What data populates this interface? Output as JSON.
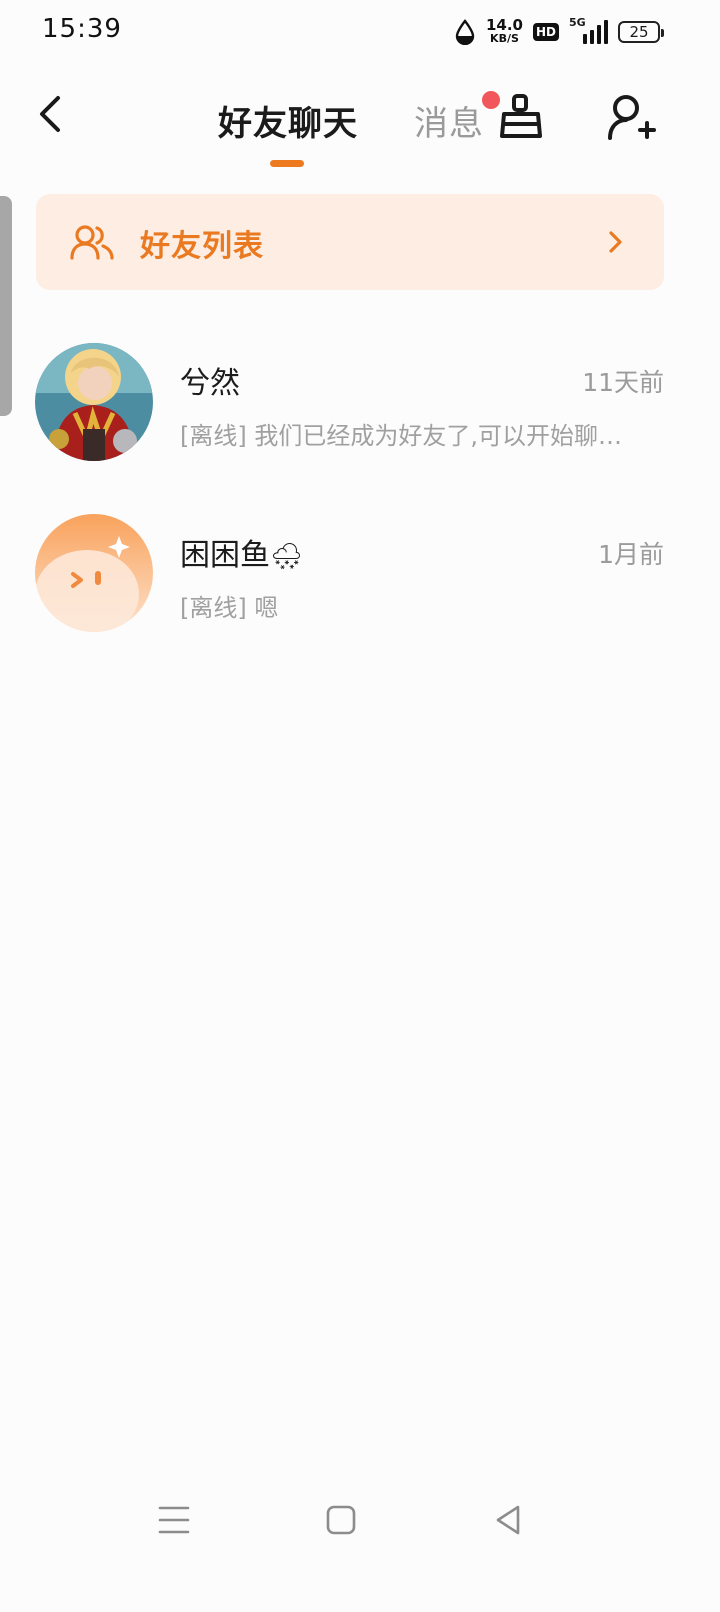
{
  "status_bar": {
    "time": "15:39",
    "net_speed_value": "14.0",
    "net_speed_unit": "KB/S",
    "hd_label": "HD",
    "network_label": "5G",
    "battery": "25"
  },
  "header": {
    "active_tab": "好友聊天",
    "inactive_tab": "消息",
    "has_unread_dot": true,
    "accent": "#ee7a1f"
  },
  "friends_banner": {
    "label": "好友列表"
  },
  "chats": [
    {
      "name": "兮然",
      "time": "11天前",
      "preview": "[离线] 我们已经成为好友了,可以开始聊…"
    },
    {
      "name": "困困鱼",
      "name_emoji": "🌨",
      "time": "1月前",
      "preview": "[离线] 嗯"
    }
  ]
}
